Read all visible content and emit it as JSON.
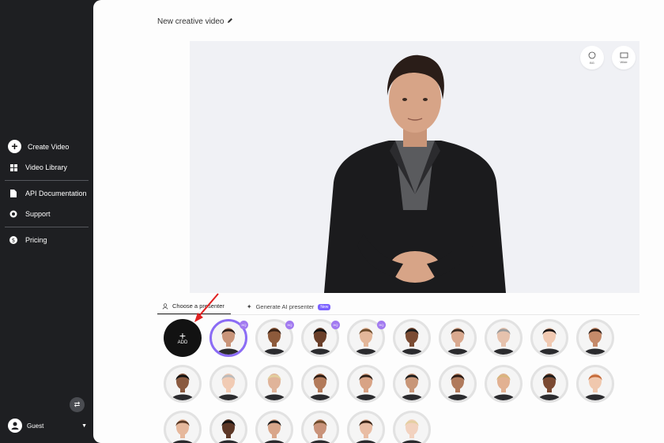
{
  "sidebar": {
    "items": [
      {
        "label": "Create Video",
        "icon": "plus-circle-icon"
      },
      {
        "label": "Video Library",
        "icon": "grid-icon"
      },
      {
        "label": "API Documentation",
        "icon": "document-icon"
      },
      {
        "label": "Support",
        "icon": "lifebuoy-icon"
      },
      {
        "label": "Pricing",
        "icon": "dollar-circle-icon"
      }
    ],
    "user": {
      "name": "Guest"
    }
  },
  "main": {
    "title": "New creative video",
    "stage_buttons": [
      {
        "label": "BG",
        "icon": "circle-icon"
      },
      {
        "label": "Wide",
        "icon": "rectangle-icon"
      }
    ],
    "tabs": [
      {
        "label": "Choose a presenter",
        "icon": "user-icon",
        "active": true
      },
      {
        "label": "Generate AI presenter",
        "icon": "sparkle-icon",
        "badge": "New"
      }
    ],
    "add_label": "ADD",
    "hq_label": "HQ"
  },
  "colors": {
    "accent": "#7b61ff",
    "sidebar_bg": "#1e1f22",
    "stage_bg": "#f0f1f5"
  }
}
